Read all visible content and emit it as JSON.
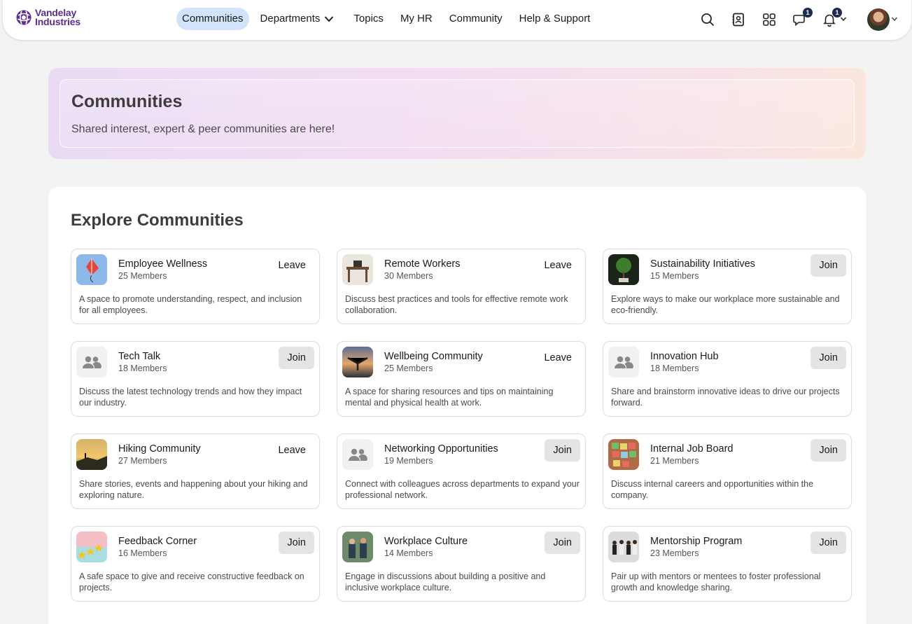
{
  "brand": {
    "name_line1": "Vandelay",
    "name_line2": "Industries",
    "color": "#5b2d8e"
  },
  "nav": {
    "items": [
      {
        "label": "Communities",
        "active": true
      },
      {
        "label": "Departments",
        "active": false,
        "has_dropdown": true
      },
      {
        "label": "Topics",
        "active": false
      },
      {
        "label": "My HR",
        "active": false
      },
      {
        "label": "Community",
        "active": false
      },
      {
        "label": "Help & Support",
        "active": false
      }
    ]
  },
  "header_actions": {
    "icons": [
      "search-icon",
      "contacts-icon",
      "apps-grid-icon",
      "chat-icon",
      "bell-icon",
      "chevron-down-icon"
    ],
    "chat_badge": "1",
    "notifications_badge": "1"
  },
  "hero": {
    "title": "Communities",
    "subtitle": "Shared interest, expert & peer communities are here!"
  },
  "explore": {
    "title": "Explore Communities",
    "cards": [
      {
        "name": "Employee Wellness",
        "members": "25 Members",
        "action": "Leave",
        "description": "A space to promote understanding, respect, and inclusion for all employees.",
        "image": "kite-image"
      },
      {
        "name": "Remote Workers",
        "members": "30 Members",
        "action": "Leave",
        "description": "Discuss best practices and tools for effective remote work collaboration.",
        "image": "desk-image"
      },
      {
        "name": "Sustainability Initiatives",
        "members": "15 Members",
        "action": "Join",
        "description": "Explore ways to make our workplace more sustainable and eco-friendly.",
        "image": "tree-image"
      },
      {
        "name": "Tech Talk",
        "members": "18 Members",
        "action": "Join",
        "description": "Discuss the latest technology trends and how they impact our industry.",
        "image": "group-placeholder-icon"
      },
      {
        "name": "Wellbeing Community",
        "members": "25 Members",
        "action": "Leave",
        "description": "A space for sharing resources and tips on maintaining mental and physical health at work.",
        "image": "sunset-person-image"
      },
      {
        "name": "Innovation Hub",
        "members": "18 Members",
        "action": "Join",
        "description": "Share and brainstorm innovative ideas to drive our projects forward.",
        "image": "group-placeholder-icon"
      },
      {
        "name": "Hiking Community",
        "members": "27 Members",
        "action": "Leave",
        "description": "Share stories, events and happening about your hiking and exploring nature.",
        "image": "hiker-image"
      },
      {
        "name": "Networking Opportunities",
        "members": "19 Members",
        "action": "Join",
        "description": "Connect with colleagues across departments to expand your professional network.",
        "image": "group-placeholder-icon"
      },
      {
        "name": "Internal Job Board",
        "members": "21 Members",
        "action": "Join",
        "description": "Discuss internal careers and opportunities within the company.",
        "image": "board-image"
      },
      {
        "name": "Feedback Corner",
        "members": "16 Members",
        "action": "Join",
        "description": "A safe space to give and receive constructive feedback on projects.",
        "image": "stars-image"
      },
      {
        "name": "Workplace Culture",
        "members": "14 Members",
        "action": "Join",
        "description": "Engage in discussions about building a positive and inclusive workplace culture.",
        "image": "people-image"
      },
      {
        "name": "Mentorship Program",
        "members": "23 Members",
        "action": "Join",
        "description": "Pair up with mentors or mentees to foster professional growth and knowledge sharing.",
        "image": "team-image"
      }
    ]
  },
  "colors": {
    "nav_active": "#d2e3fb",
    "join_button": "#e4e4e4",
    "badge": "#1d2b4f"
  }
}
